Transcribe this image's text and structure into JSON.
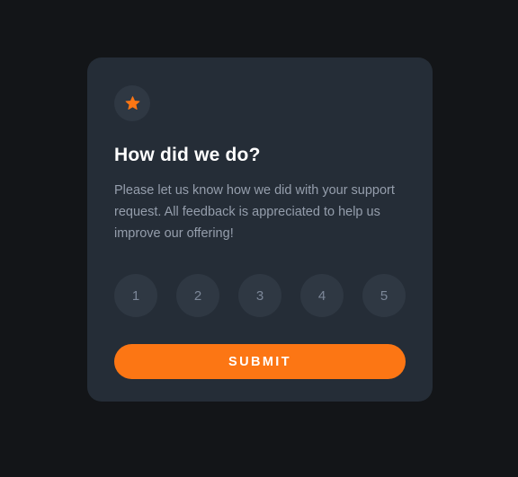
{
  "card": {
    "icon": "star-icon",
    "title": "How did we do?",
    "description": "Please let us know how we did with your support request. All feedback is appreciated to help us improve our offering!",
    "ratings": [
      "1",
      "2",
      "3",
      "4",
      "5"
    ],
    "submit_label": "SUBMIT"
  },
  "colors": {
    "background": "#131518",
    "card": "#252d37",
    "circle": "#2f3843",
    "accent": "#fc7614",
    "text_muted": "#959eac",
    "rating_text": "#7c8798"
  }
}
